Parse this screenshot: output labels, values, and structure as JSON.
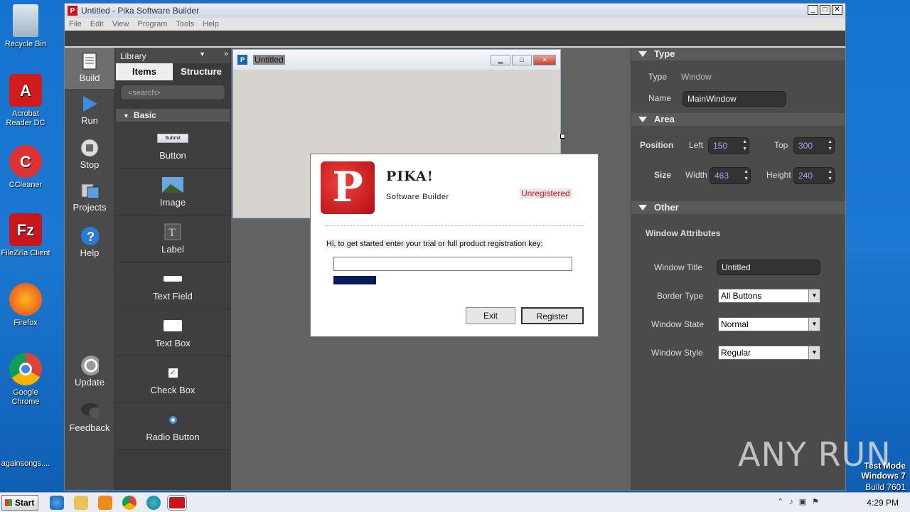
{
  "desktop": {
    "icons": [
      {
        "label": "Recycle Bin"
      },
      {
        "label": "Acrobat Reader DC"
      },
      {
        "label": "CCleaner"
      },
      {
        "label": "FileZilla Client"
      },
      {
        "label": "Firefox"
      },
      {
        "label": "Google Chrome"
      },
      {
        "label": "againsongs...."
      }
    ],
    "watermark": "ANY RUN",
    "test_mode": [
      "Test Mode",
      "Windows 7",
      "Build 7601"
    ]
  },
  "window": {
    "title": "Untitled - Pika Software Builder",
    "menu": [
      "File",
      "Edit",
      "View",
      "Program",
      "Tools",
      "Help"
    ]
  },
  "toolbar": {
    "build": "Build",
    "run": "Run",
    "stop": "Stop",
    "projects": "Projects",
    "help": "Help",
    "update": "Update",
    "feedback": "Feedback"
  },
  "library": {
    "dropdown": "Library",
    "tabs": [
      "Items",
      "Structure"
    ],
    "search_placeholder": "<search>",
    "section": "Basic",
    "items": [
      "Button",
      "Image",
      "Label",
      "Text Field",
      "Text Box",
      "Check Box",
      "Radio Button"
    ],
    "button_preview": "Submit"
  },
  "design_window": {
    "title": "Untitled"
  },
  "properties": {
    "type_section": "Type",
    "type_label": "Type",
    "type_value": "Window",
    "name_label": "Name",
    "name_value": "MainWindow",
    "area_section": "Area",
    "position_label": "Position",
    "left_label": "Left",
    "left_value": "150",
    "top_label": "Top",
    "top_value": "300",
    "size_label": "Size",
    "width_label": "Width",
    "width_value": "463",
    "height_label": "Height",
    "height_value": "240",
    "other_section": "Other",
    "window_attributes": "Window Attributes",
    "window_title_label": "Window Title",
    "window_title_value": "Untitled",
    "border_type_label": "Border Type",
    "border_type_value": "All Buttons",
    "window_state_label": "Window State",
    "window_state_value": "Normal",
    "window_style_label": "Window Style",
    "window_style_value": "Regular"
  },
  "dialog": {
    "app_name": "PIKA!",
    "subtitle": "Software Builder",
    "status": "Unregistered",
    "message": "Hi, to get started enter your trial or full product registration key:",
    "exit": "Exit",
    "register": "Register"
  },
  "taskbar": {
    "start": "Start",
    "time": "4:29 PM"
  }
}
